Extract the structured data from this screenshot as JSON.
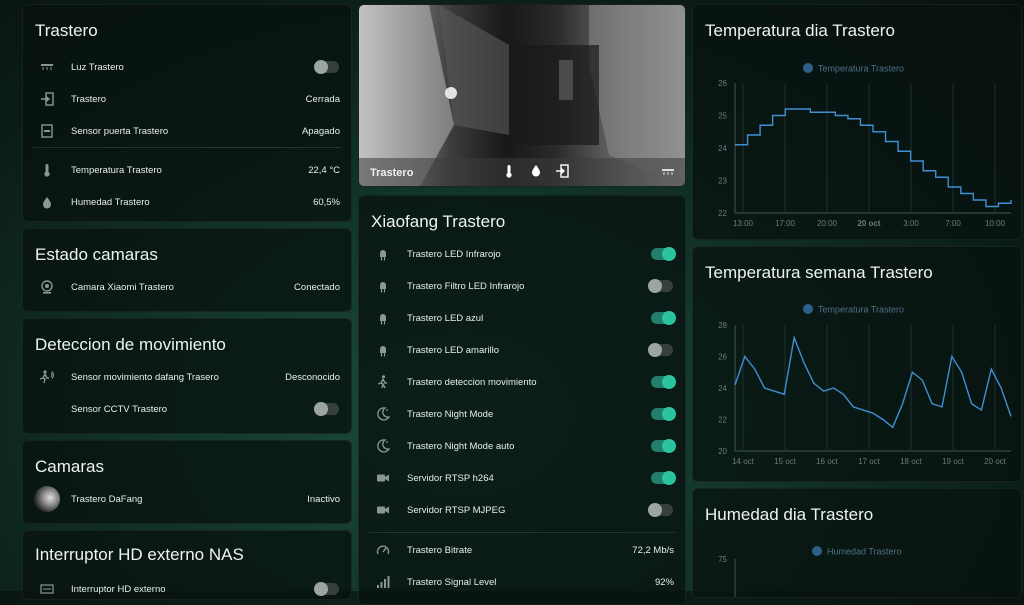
{
  "trastero": {
    "title": "Trastero",
    "rows": [
      {
        "icon": "ceiling-light-icon",
        "label": "Luz Trastero",
        "value": ""
      },
      {
        "icon": "door-enter-icon",
        "label": "Trastero",
        "value": "Cerrada"
      },
      {
        "icon": "door-sensor-icon",
        "label": "Sensor puerta Trastero",
        "value": "Apagado"
      },
      {
        "icon": "thermometer-icon",
        "label": "Temperatura Trastero",
        "value": "22,4 °C"
      },
      {
        "icon": "water-drop-icon",
        "label": "Humedad Trastero",
        "value": "60,5%"
      }
    ]
  },
  "estado": {
    "title": "Estado camaras",
    "rows": [
      {
        "icon": "webcam-icon",
        "label": "Camara Xiaomi Trastero",
        "value": "Conectado"
      }
    ]
  },
  "deteccion": {
    "title": "Deteccion de movimiento",
    "rows": [
      {
        "icon": "motion-sensor-icon",
        "label": "Sensor movimiento dafang Trasero",
        "value": "Desconocido"
      },
      {
        "icon": "",
        "label": "Sensor CCTV Trastero",
        "value": ""
      }
    ]
  },
  "camaras": {
    "title": "Camaras",
    "rows": [
      {
        "icon": "camera-thumbnail",
        "label": "Trastero DaFang",
        "value": "Inactivo"
      }
    ]
  },
  "interruptor": {
    "title": "Interruptor HD externo NAS",
    "rows": [
      {
        "icon": "hdd-icon",
        "label": "Interruptor HD externo",
        "value": ""
      }
    ]
  },
  "camera_view": {
    "title": "Trastero"
  },
  "xiaofang": {
    "title": "Xiaofang Trastero",
    "switches": [
      {
        "icon": "led-icon",
        "label": "Trastero LED Infrarojo",
        "on": true
      },
      {
        "icon": "led-icon",
        "label": "Trastero Filtro LED Infrarojo",
        "on": false
      },
      {
        "icon": "led-icon",
        "label": "Trastero LED azul",
        "on": true
      },
      {
        "icon": "led-icon",
        "label": "Trastero LED amarillo",
        "on": false
      },
      {
        "icon": "walk-icon",
        "label": "Trastero deteccion movimiento",
        "on": true
      },
      {
        "icon": "moon-icon",
        "label": "Trastero Night Mode",
        "on": true
      },
      {
        "icon": "moon-icon",
        "label": "Trastero Night Mode auto",
        "on": true
      },
      {
        "icon": "video-icon",
        "label": "Servidor RTSP h264",
        "on": true
      },
      {
        "icon": "video-icon",
        "label": "Servidor RTSP MJPEG",
        "on": false
      }
    ],
    "sensors": [
      {
        "icon": "speedometer-icon",
        "label": "Trastero Bitrate",
        "value": "72,2 Mb/s"
      },
      {
        "icon": "signal-icon",
        "label": "Trastero Signal Level",
        "value": "92%"
      }
    ]
  },
  "colors": {
    "accent": "#2bc3a0",
    "line": "#3f8fd2",
    "bg": "#0b1c17"
  },
  "chart_data": [
    {
      "type": "line",
      "title": "Temperatura dia Trastero",
      "series": [
        {
          "name": "Temperatura Trastero",
          "values": [
            24.1,
            24.4,
            24.7,
            25.0,
            25.2,
            25.2,
            25.1,
            25.1,
            25.0,
            24.9,
            24.7,
            24.5,
            24.2,
            23.9,
            23.6,
            23.3,
            23.1,
            22.8,
            22.6,
            22.4,
            22.2,
            22.3,
            22.4
          ]
        }
      ],
      "x_ticks": [
        "13:00",
        "17:00",
        "20:00",
        "20 oct",
        "3:00",
        "7:00",
        "10:00"
      ],
      "y_ticks": [
        "26",
        "25",
        "24",
        "23",
        "22"
      ],
      "ylim": [
        22,
        26
      ]
    },
    {
      "type": "line",
      "title": "Temperatura semana Trastero",
      "series": [
        {
          "name": "Temperatura Trastero",
          "values": [
            24.2,
            26.0,
            25.2,
            24.0,
            23.8,
            23.6,
            27.2,
            25.6,
            24.3,
            23.8,
            24.0,
            23.6,
            22.8,
            22.6,
            22.4,
            22.0,
            21.5,
            23.0,
            25.0,
            24.5,
            23.0,
            22.8,
            26.0,
            25.0,
            23.0,
            22.6,
            25.2,
            24.0,
            22.2
          ]
        }
      ],
      "x_ticks": [
        "14 oct",
        "15 oct",
        "16 oct",
        "17 oct",
        "18 oct",
        "19 oct",
        "20 oct"
      ],
      "y_ticks": [
        "28",
        "26",
        "24",
        "22",
        "20"
      ],
      "ylim": [
        20,
        28
      ]
    },
    {
      "type": "line",
      "title": "Humedad dia Trastero",
      "series": [
        {
          "name": "Humedad Trastero",
          "values": []
        }
      ],
      "x_ticks": [],
      "y_ticks": [
        "75"
      ],
      "ylim": [
        60,
        75
      ]
    }
  ]
}
